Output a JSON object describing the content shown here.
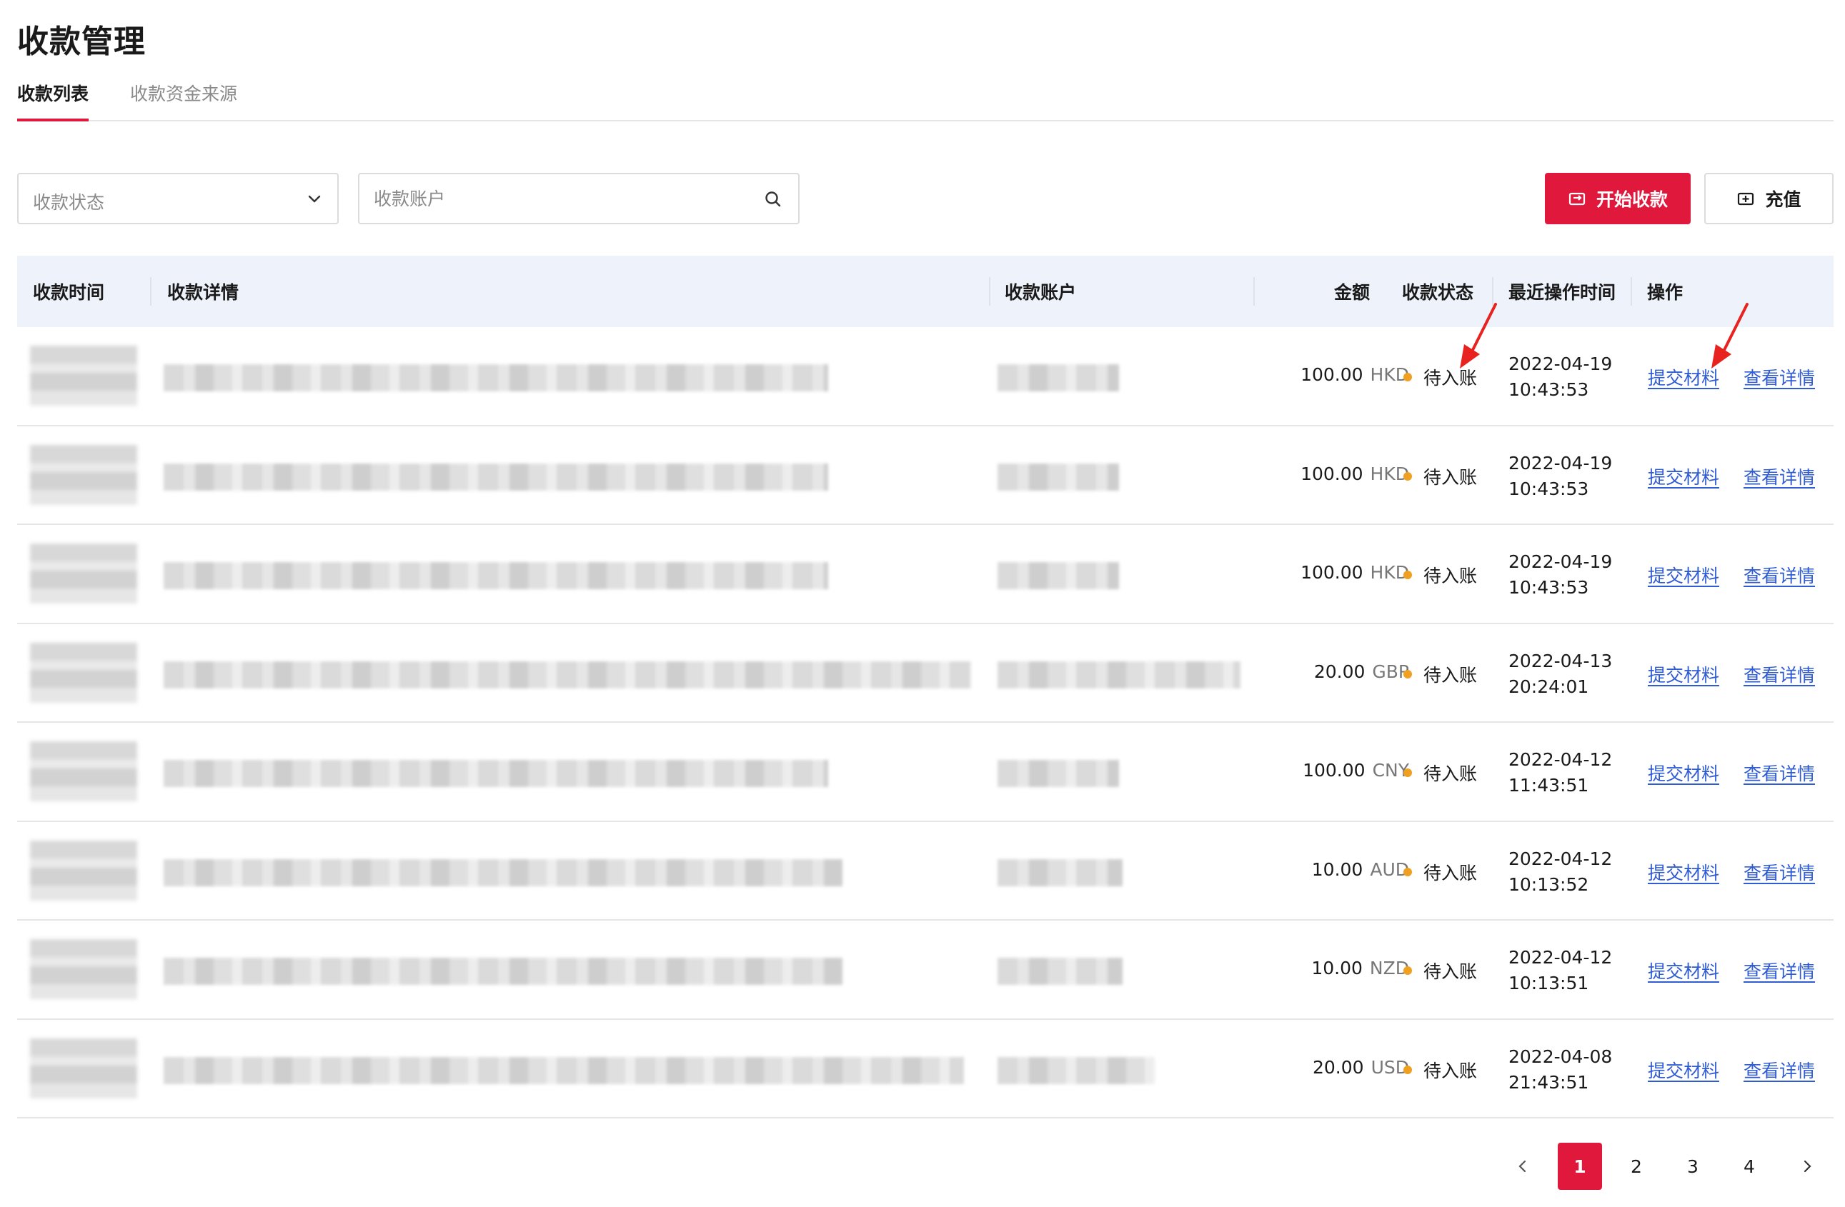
{
  "page": {
    "title": "收款管理"
  },
  "tabs": [
    {
      "label": "收款列表",
      "active": true
    },
    {
      "label": "收款资金来源",
      "active": false
    }
  ],
  "filters": {
    "status_placeholder": "收款状态",
    "account_placeholder": "收款账户"
  },
  "actions": {
    "start_label": "开始收款",
    "recharge_label": "充值"
  },
  "table": {
    "headers": {
      "time": "收款时间",
      "detail": "收款详情",
      "account": "收款账户",
      "amount": "金额",
      "status": "收款状态",
      "last_op": "最近操作时间",
      "ops": "操作"
    },
    "rows": [
      {
        "amount": "100.00",
        "currency": "HKD",
        "status": "待入账",
        "date": "2022-04-19",
        "time": "10:43:53",
        "submit": "提交材料",
        "detail": "查看详情"
      },
      {
        "amount": "100.00",
        "currency": "HKD",
        "status": "待入账",
        "date": "2022-04-19",
        "time": "10:43:53",
        "submit": "提交材料",
        "detail": "查看详情"
      },
      {
        "amount": "100.00",
        "currency": "HKD",
        "status": "待入账",
        "date": "2022-04-19",
        "time": "10:43:53",
        "submit": "提交材料",
        "detail": "查看详情"
      },
      {
        "amount": "20.00",
        "currency": "GBP",
        "status": "待入账",
        "date": "2022-04-13",
        "time": "20:24:01",
        "submit": "提交材料",
        "detail": "查看详情"
      },
      {
        "amount": "100.00",
        "currency": "CNY",
        "status": "待入账",
        "date": "2022-04-12",
        "time": "11:43:51",
        "submit": "提交材料",
        "detail": "查看详情"
      },
      {
        "amount": "10.00",
        "currency": "AUD",
        "status": "待入账",
        "date": "2022-04-12",
        "time": "10:13:52",
        "submit": "提交材料",
        "detail": "查看详情"
      },
      {
        "amount": "10.00",
        "currency": "NZD",
        "status": "待入账",
        "date": "2022-04-12",
        "time": "10:13:51",
        "submit": "提交材料",
        "detail": "查看详情"
      },
      {
        "amount": "20.00",
        "currency": "USD",
        "status": "待入账",
        "date": "2022-04-08",
        "time": "21:43:51",
        "submit": "提交材料",
        "detail": "查看详情"
      }
    ]
  },
  "pagination": {
    "pages": [
      "1",
      "2",
      "3",
      "4"
    ],
    "current": "1"
  },
  "colors": {
    "accent": "#e0183c",
    "link": "#2f5bd3",
    "status_pending": "#f0a020",
    "header_bg": "#eef3fb"
  },
  "icons": {
    "select": "chevron-down-icon",
    "search": "search-icon",
    "start": "transfer-icon",
    "recharge": "wallet-icon",
    "prev": "chevron-left-icon",
    "next": "chevron-right-icon"
  }
}
